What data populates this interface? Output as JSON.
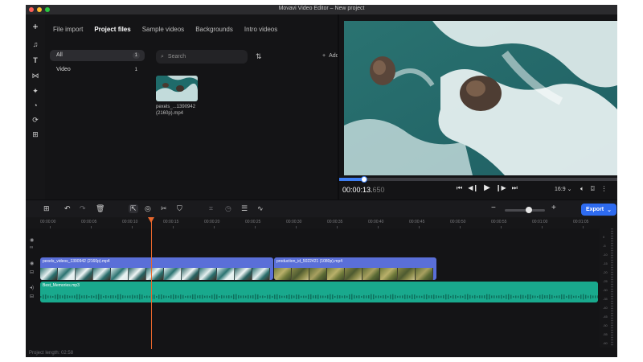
{
  "window": {
    "title": "Movavi Video Editor – New project"
  },
  "media_panel": {
    "tabs": [
      {
        "label": "File import"
      },
      {
        "label": "Project files",
        "active": true
      },
      {
        "label": "Sample videos"
      },
      {
        "label": "Backgrounds"
      },
      {
        "label": "Intro videos"
      }
    ],
    "categories": [
      {
        "label": "All",
        "count": "1"
      },
      {
        "label": "Video",
        "count": "1"
      }
    ],
    "search_placeholder": "Search",
    "add_label": "Add",
    "file": {
      "name_line1": "pexels_...1390942",
      "name_line2": "(2160p).mp4"
    }
  },
  "preview": {
    "timecode_main": "00:00:13.",
    "timecode_ms": "650",
    "aspect_ratio": "16:9",
    "progress": 0.09
  },
  "timeline": {
    "export_label": "Export",
    "ruler_ticks": [
      "00:00:00",
      "00:00:05",
      "00:00:10",
      "00:00:15",
      "00:00:20",
      "00:00:25",
      "00:00:30",
      "00:00:35",
      "00:00:40",
      "00:00:45",
      "00:00:50",
      "00:00:55",
      "00:01:00",
      "00:01:05"
    ],
    "clips": {
      "video1": "pexels_videos_1390942 (2160p).mp4",
      "video2": "production_id_5022421 (1080p).mp4",
      "audio": "Best_Memories.mp3"
    },
    "meter_labels": [
      "0",
      "-5",
      "-10",
      "-15",
      "-20",
      "-25",
      "-30",
      "-35",
      "-40",
      "-45",
      "-50",
      "-55",
      "-60"
    ],
    "project_length": "Project length: 02:58"
  },
  "colors": {
    "accent": "#2e6bf0",
    "video_clip": "#5a6fd8",
    "audio_clip": "#19a98d",
    "playhead": "#e8672c"
  }
}
